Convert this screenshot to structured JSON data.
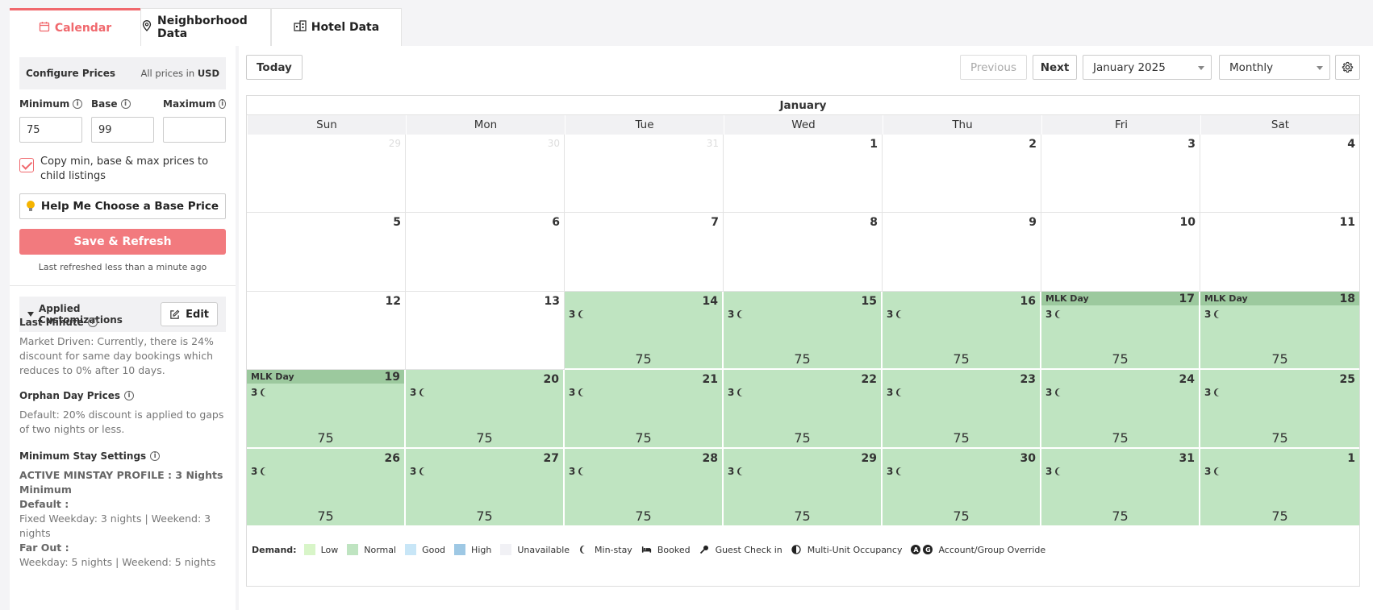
{
  "tabs": [
    {
      "label": "Calendar",
      "icon": "calendar-icon",
      "active": true
    },
    {
      "label": "Neighborhood Data",
      "icon": "map-pin-icon"
    },
    {
      "label": "Hotel Data",
      "icon": "building-icon"
    }
  ],
  "configure": {
    "title": "Configure Prices",
    "currency_note_prefix": "All prices in",
    "currency": "USD",
    "minimum": {
      "label": "Minimum",
      "value": "75"
    },
    "base": {
      "label": "Base",
      "value": "99"
    },
    "maximum": {
      "label": "Maximum",
      "value": ""
    },
    "copy_label": "Copy min, base & max prices to child listings",
    "help_label": "Help Me Choose a Base Price",
    "save_label": "Save & Refresh",
    "last_refreshed": "Last refreshed less than a minute ago"
  },
  "customizations": {
    "title": "Applied Customizations",
    "edit_label": "Edit",
    "last_minute": {
      "title": "Last Minute",
      "desc": "Market Driven: Currently, there is 24% discount for same day bookings which reduces to 0% after 10 days."
    },
    "orphan": {
      "title": "Orphan Day Prices",
      "desc": "Default: 20% discount is applied to gaps of two nights or less."
    },
    "min_stay": {
      "title": "Minimum Stay Settings",
      "active_profile": "ACTIVE MINSTAY PROFILE : 3 Nights Minimum",
      "default_label": "Default :",
      "default_text": "Fixed Weekday: 3 nights | Weekend: 3 nights",
      "far_out_label": "Far Out :",
      "far_out_text": "Weekday: 5 nights | Weekend: 5 nights"
    }
  },
  "toolbar": {
    "today": "Today",
    "previous": "Previous",
    "next": "Next",
    "month_select": "January 2025",
    "view_select": "Monthly"
  },
  "calendar": {
    "month_title": "January",
    "weekdays": [
      "Sun",
      "Mon",
      "Tue",
      "Wed",
      "Thu",
      "Fri",
      "Sat"
    ],
    "cells": [
      {
        "day": "29",
        "muted": true
      },
      {
        "day": "30",
        "muted": true
      },
      {
        "day": "31",
        "muted": true
      },
      {
        "day": "1"
      },
      {
        "day": "2"
      },
      {
        "day": "3"
      },
      {
        "day": "4"
      },
      {
        "day": "5"
      },
      {
        "day": "6"
      },
      {
        "day": "7"
      },
      {
        "day": "8"
      },
      {
        "day": "9"
      },
      {
        "day": "10"
      },
      {
        "day": "11"
      },
      {
        "day": "12"
      },
      {
        "day": "13"
      },
      {
        "day": "14",
        "minstay": "3",
        "price": "75",
        "demand": "normal"
      },
      {
        "day": "15",
        "minstay": "3",
        "price": "75",
        "demand": "normal"
      },
      {
        "day": "16",
        "minstay": "3",
        "price": "75",
        "demand": "normal"
      },
      {
        "day": "17",
        "minstay": "3",
        "price": "75",
        "demand": "normal",
        "holiday": "MLK Day"
      },
      {
        "day": "18",
        "minstay": "3",
        "price": "75",
        "demand": "normal",
        "holiday": "MLK Day"
      },
      {
        "day": "19",
        "minstay": "3",
        "price": "75",
        "demand": "normal",
        "holiday": "MLK Day"
      },
      {
        "day": "20",
        "minstay": "3",
        "price": "75",
        "demand": "normal"
      },
      {
        "day": "21",
        "minstay": "3",
        "price": "75",
        "demand": "normal"
      },
      {
        "day": "22",
        "minstay": "3",
        "price": "75",
        "demand": "normal"
      },
      {
        "day": "23",
        "minstay": "3",
        "price": "75",
        "demand": "normal"
      },
      {
        "day": "24",
        "minstay": "3",
        "price": "75",
        "demand": "normal"
      },
      {
        "day": "25",
        "minstay": "3",
        "price": "75",
        "demand": "normal"
      },
      {
        "day": "26",
        "minstay": "3",
        "price": "75",
        "demand": "normal"
      },
      {
        "day": "27",
        "minstay": "3",
        "price": "75",
        "demand": "normal"
      },
      {
        "day": "28",
        "minstay": "3",
        "price": "75",
        "demand": "normal"
      },
      {
        "day": "29",
        "minstay": "3",
        "price": "75",
        "demand": "normal"
      },
      {
        "day": "30",
        "minstay": "3",
        "price": "75",
        "demand": "normal"
      },
      {
        "day": "31",
        "minstay": "3",
        "price": "75",
        "demand": "normal"
      },
      {
        "day": "1",
        "minstay": "3",
        "price": "75",
        "demand": "normal"
      }
    ]
  },
  "legend": {
    "title": "Demand:",
    "items": [
      {
        "label": "Low",
        "color": "#d8f5c8"
      },
      {
        "label": "Normal",
        "color": "#bfe4c1"
      },
      {
        "label": "Good",
        "color": "#c8e6f7"
      },
      {
        "label": "High",
        "color": "#9ec8e4"
      },
      {
        "label": "Unavailable",
        "color": "#f1f1f5"
      }
    ],
    "min_stay": "Min-stay",
    "booked": "Booked",
    "check_in": "Guest Check in",
    "multi_unit": "Multi-Unit Occupancy",
    "override": "Account/Group Override",
    "override_badges": [
      "A",
      "G"
    ]
  },
  "colors": {
    "accent": "#f0686d",
    "normal_demand": "#bfe4c1",
    "holiday_band": "#9cc99e"
  }
}
